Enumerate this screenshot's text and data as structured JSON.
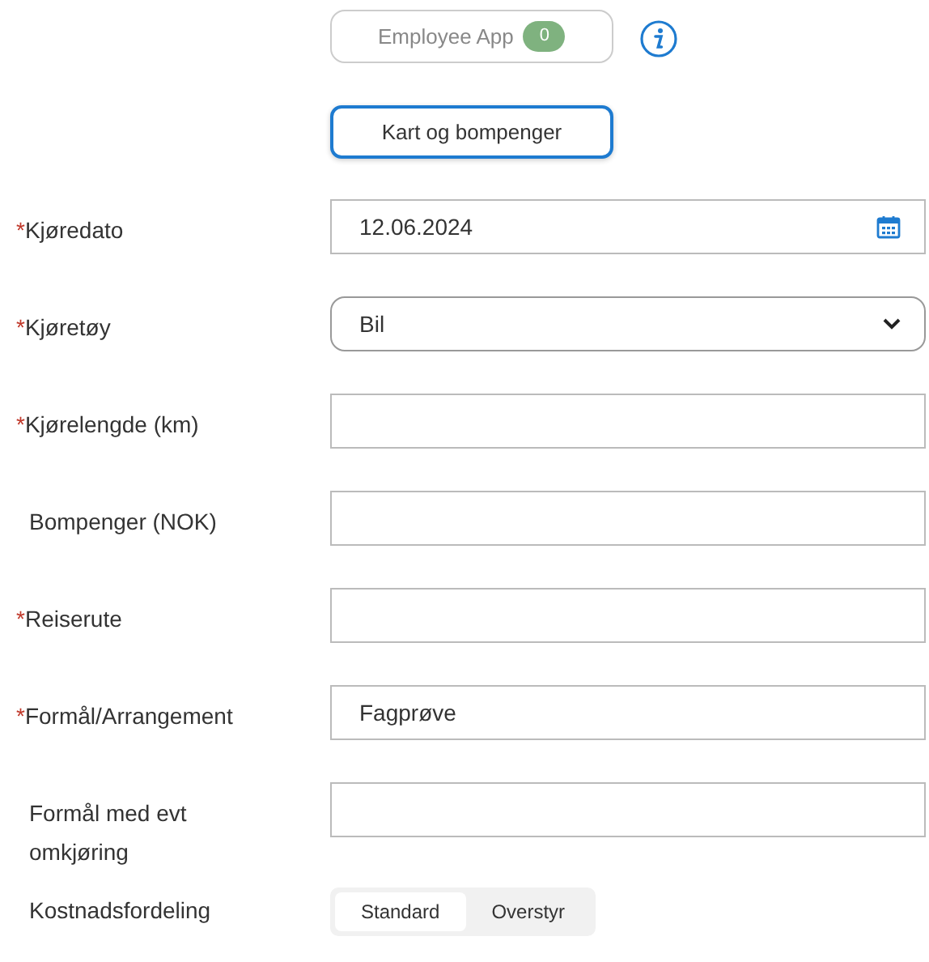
{
  "app_button": {
    "label": "Employee App",
    "count": "0"
  },
  "map_button": {
    "label": "Kart og bompenger"
  },
  "fields": [
    {
      "kind": "date",
      "marker": "*",
      "label": "Kjøredato",
      "value": "12.06.2024"
    },
    {
      "kind": "select",
      "marker": "*",
      "label": "Kjøretøy",
      "value": "Bil"
    },
    {
      "kind": "text",
      "marker": "*",
      "label": "Kjørelengde (km)"
    },
    {
      "kind": "text",
      "label": "Bompenger (NOK)"
    },
    {
      "kind": "text",
      "marker": "*",
      "label": "Reiserute"
    },
    {
      "kind": "text",
      "marker": "*",
      "label": "Formål/Arrangement",
      "value": "Fagprøve"
    },
    {
      "kind": "text",
      "label": "Formål med evt omkjøring"
    },
    {
      "kind": "segmented",
      "label": "Kostnadsfordeling",
      "options": [
        {
          "label": "Standard",
          "selected": true
        },
        {
          "label": "Overstyr",
          "selected": false
        }
      ]
    }
  ]
}
